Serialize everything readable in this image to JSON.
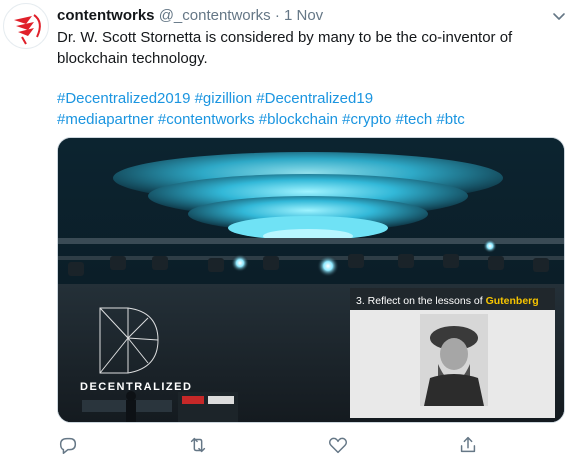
{
  "tweet": {
    "author_name": "contentworks",
    "author_handle": "@_contentworks",
    "separator": "·",
    "timestamp": "1 Nov",
    "text": "Dr. W. Scott Stornetta is considered by many to be the co-inventor of blockchain technology.",
    "hashtag_lines": [
      "#Decentralized2019 #gizillion  #Decentralized19",
      "#mediapartner #contentworks #blockchain #crypto #tech #btc"
    ]
  },
  "media": {
    "slide_title_prefix": "3. Reflect on the lessons of ",
    "slide_title_highlight": "Gutenberg",
    "event_logo_text": "DECENTRALIZED"
  },
  "colors": {
    "link": "#1b95e0",
    "secondary_text": "#657786",
    "primary_text": "#14171a",
    "slide_highlight": "#f5c400",
    "avatar_red": "#e0202a"
  },
  "icons": {
    "avatar": "contentworks-logo",
    "more": "chevron-down-icon",
    "reply": "reply-icon",
    "retweet": "retweet-icon",
    "like": "heart-icon",
    "share": "share-icon"
  }
}
